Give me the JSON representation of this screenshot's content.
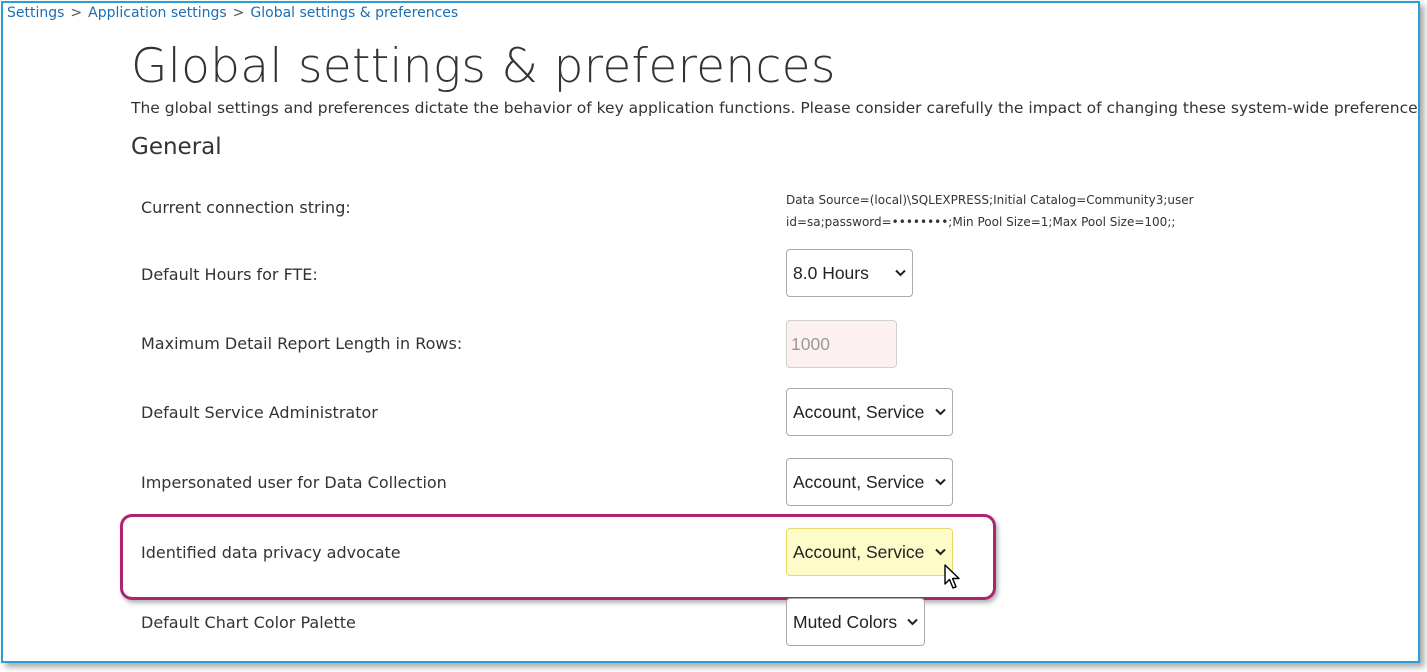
{
  "breadcrumb": {
    "items": [
      "Settings",
      "Application settings",
      "Global settings & preferences"
    ],
    "separator": ">"
  },
  "page": {
    "title": "Global settings & preferences",
    "description": "The global settings and preferences dictate the behavior of key application functions. Please consider carefully the impact of changing these system-wide preference variables."
  },
  "section": {
    "title": "General"
  },
  "settings": {
    "connection_string": {
      "label": "Current connection string:",
      "value_line1": "Data Source=(local)\\SQLEXPRESS;Initial Catalog=Community3;user",
      "value_line2": "id=sa;password=••••••••;Min Pool Size=1;Max Pool Size=100;;"
    },
    "fte_hours": {
      "label": "Default Hours for FTE:",
      "selected": "8.0 Hours"
    },
    "max_report_rows": {
      "label": "Maximum Detail Report Length in Rows:",
      "value": "1000"
    },
    "service_admin": {
      "label": "Default Service Administrator",
      "selected": "Account, Service"
    },
    "impersonated_user": {
      "label": "Impersonated user for Data Collection",
      "selected": "Account, Service"
    },
    "privacy_advocate": {
      "label": "Identified data privacy advocate",
      "selected": "Account, Service"
    },
    "chart_palette": {
      "label": "Default Chart Color Palette",
      "selected": "Muted Colors"
    }
  },
  "colors": {
    "frame_border": "#2a9fd6",
    "link": "#1a6fb3",
    "callout": "#b0246f",
    "highlight_bg": "#fdfcc9",
    "disabled_bg": "#fdf0f0"
  }
}
